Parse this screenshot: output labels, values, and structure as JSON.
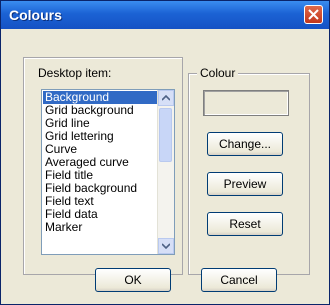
{
  "window": {
    "title": "Colours"
  },
  "desktop_group": {
    "label": "Desktop item:",
    "items": [
      "Background",
      "Grid background",
      "Grid line",
      "Grid lettering",
      "Curve",
      "Averaged curve",
      "Field title",
      "Field background",
      "Field text",
      "Field data",
      "Marker"
    ],
    "selected_index": 0
  },
  "colour_group": {
    "label": "Colour",
    "swatch_color": "#ece9d8",
    "change_label": "Change...",
    "preview_label": "Preview",
    "reset_label": "Reset"
  },
  "buttons": {
    "ok_label": "OK",
    "cancel_label": "Cancel"
  },
  "icons": {
    "close": "close-icon",
    "scroll_up": "chevron-up-icon",
    "scroll_down": "chevron-down-icon"
  }
}
